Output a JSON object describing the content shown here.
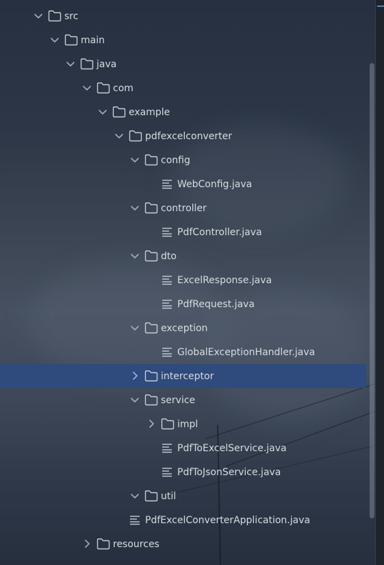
{
  "tree": {
    "items": [
      {
        "label": "src",
        "icon": "folder-icon",
        "expand": "expanded"
      },
      {
        "label": "main",
        "icon": "folder-icon",
        "expand": "expanded"
      },
      {
        "label": "java",
        "icon": "folder-icon",
        "expand": "expanded"
      },
      {
        "label": "com",
        "icon": "folder-icon",
        "expand": "expanded"
      },
      {
        "label": "example",
        "icon": "folder-icon",
        "expand": "expanded"
      },
      {
        "label": "pdfexcelconverter",
        "icon": "folder-icon",
        "expand": "expanded"
      },
      {
        "label": "config",
        "icon": "folder-icon",
        "expand": "expanded"
      },
      {
        "label": "WebConfig.java",
        "icon": "java-file-icon",
        "expand": "none"
      },
      {
        "label": "controller",
        "icon": "folder-icon",
        "expand": "expanded"
      },
      {
        "label": "PdfController.java",
        "icon": "java-file-icon",
        "expand": "none"
      },
      {
        "label": "dto",
        "icon": "folder-icon",
        "expand": "expanded"
      },
      {
        "label": "ExcelResponse.java",
        "icon": "java-file-icon",
        "expand": "none"
      },
      {
        "label": "PdfRequest.java",
        "icon": "java-file-icon",
        "expand": "none"
      },
      {
        "label": "exception",
        "icon": "folder-icon",
        "expand": "expanded"
      },
      {
        "label": "GlobalExceptionHandler.java",
        "icon": "java-file-icon",
        "expand": "none"
      },
      {
        "label": "interceptor",
        "icon": "folder-icon",
        "expand": "collapsed",
        "selected": true
      },
      {
        "label": "service",
        "icon": "folder-icon",
        "expand": "expanded"
      },
      {
        "label": "impl",
        "icon": "folder-icon",
        "expand": "collapsed"
      },
      {
        "label": "PdfToExcelService.java",
        "icon": "java-file-icon",
        "expand": "none"
      },
      {
        "label": "PdfToJsonService.java",
        "icon": "java-file-icon",
        "expand": "none"
      },
      {
        "label": "util",
        "icon": "folder-icon",
        "expand": "expanded"
      },
      {
        "label": "PdfExcelConverterApplication.java",
        "icon": "java-file-icon",
        "expand": "none"
      },
      {
        "label": "resources",
        "icon": "folder-icon",
        "expand": "collapsed"
      }
    ]
  },
  "colors": {
    "selected_row": "#2f4a7c",
    "text": "#d8dce2",
    "chevron": "#a8aeb8",
    "chevron_selected": "#8fb4ff",
    "icon_stroke": "#c9ced6"
  }
}
